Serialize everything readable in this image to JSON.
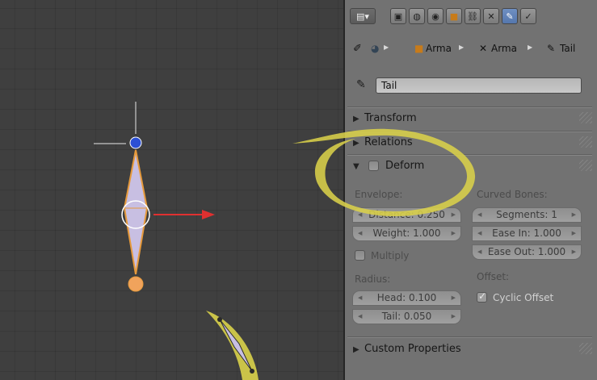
{
  "header": {
    "context_icons": [
      {
        "name": "render-icon",
        "glyph": "▣"
      },
      {
        "name": "render-layers-icon",
        "glyph": "◍"
      },
      {
        "name": "world-icon",
        "glyph": "◉"
      },
      {
        "name": "object-icon",
        "glyph": "■"
      },
      {
        "name": "constraints-icon",
        "glyph": "⛓"
      },
      {
        "name": "armature-data-icon",
        "glyph": "✕"
      },
      {
        "name": "bone-icon",
        "glyph": "✎"
      },
      {
        "name": "bone-constraints-icon",
        "glyph": "✓"
      }
    ],
    "active_tab": "bone-icon"
  },
  "breadcrumb": {
    "items": [
      "Arma",
      "Arma",
      "Tail"
    ]
  },
  "bone": {
    "name": "Tail"
  },
  "panels": {
    "transform": "Transform",
    "relations": "Relations",
    "deform": "Deform",
    "custom_properties": "Custom Properties"
  },
  "deform": {
    "envelope_label": "Envelope:",
    "distance": "Distance: 0.250",
    "weight": "Weight: 1.000",
    "multiply": "Multiply",
    "radius_label": "Radius:",
    "head": "Head: 0.100",
    "tail": "Tail: 0.050",
    "curved_bones_label": "Curved Bones:",
    "segments": "Segments: 1",
    "ease_in": "Ease In: 1.000",
    "ease_out": "Ease Out: 1.000",
    "offset_label": "Offset:",
    "cyclic_offset": "Cyclic Offset",
    "deform_enabled": false,
    "multiply_enabled": false,
    "cyclic_offset_enabled": true
  },
  "colors": {
    "panel_bg": "#727272",
    "viewport_bg": "#3f3f3f",
    "bone_fill": "#c9bfe0",
    "bone_outline": "#e69a3c",
    "annotation": "#d9d04a",
    "active_tab": "#5a7ab0",
    "x_axis": "#e03030"
  }
}
